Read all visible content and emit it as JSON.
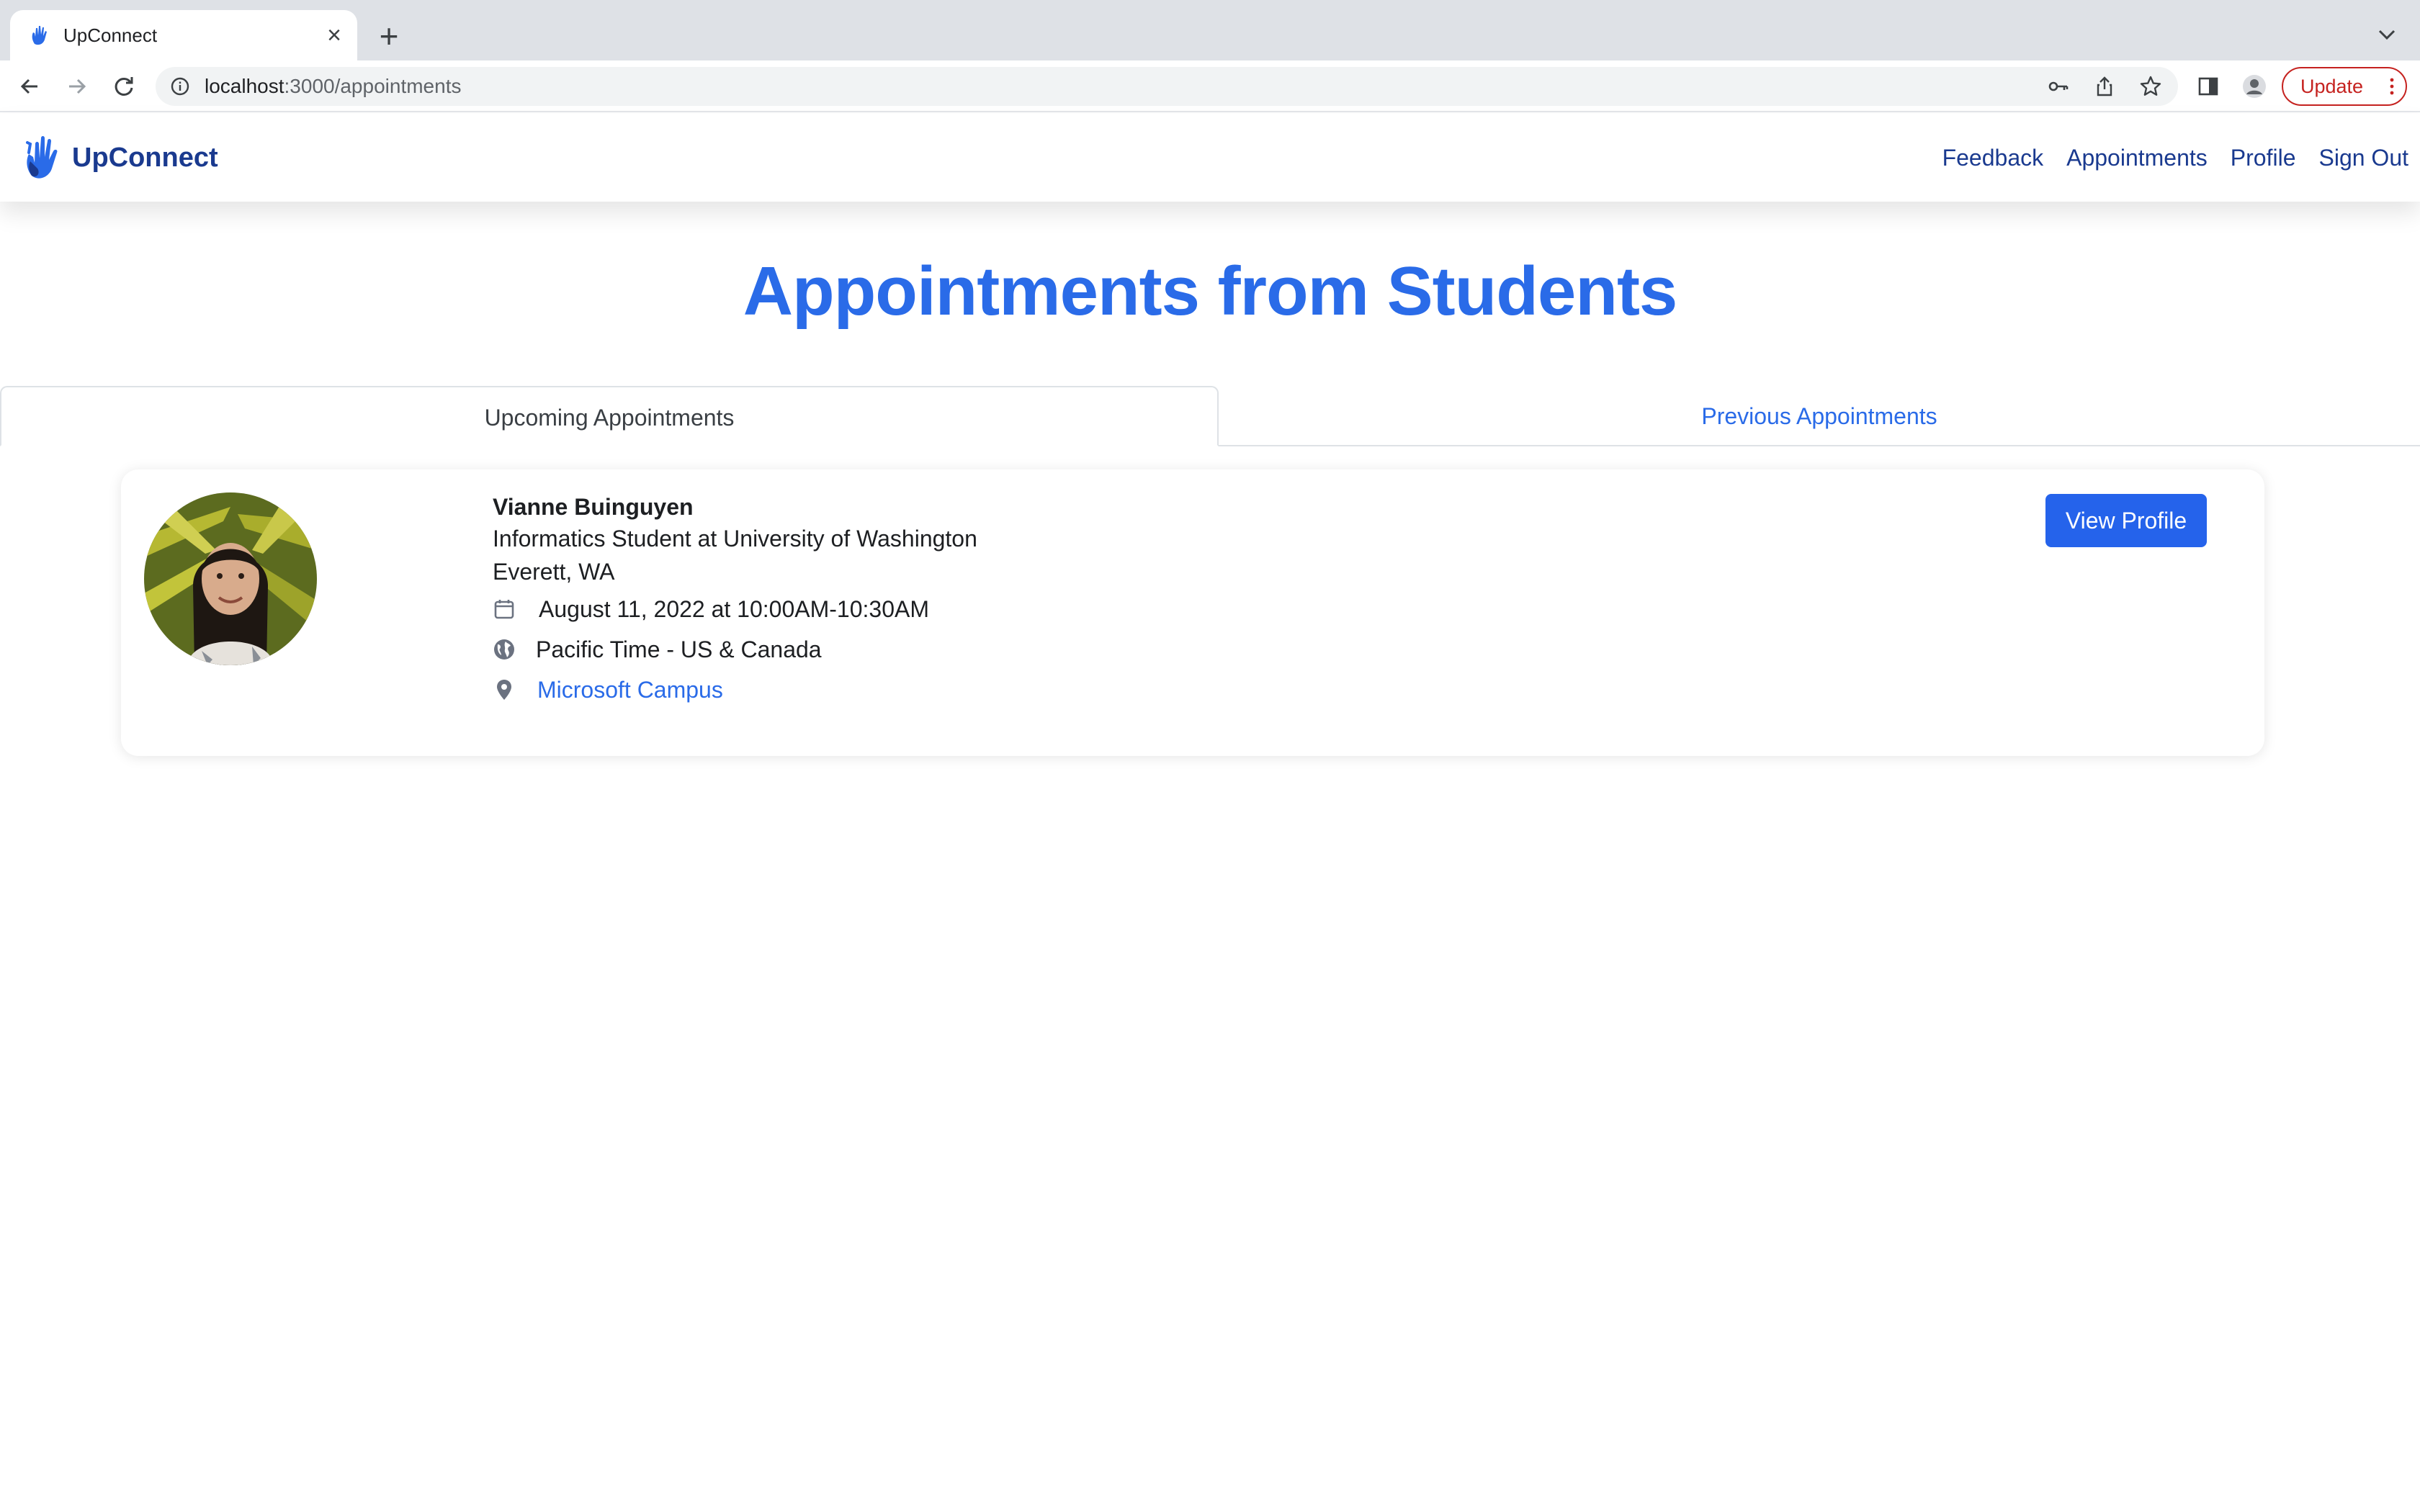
{
  "browser": {
    "tab_title": "UpConnect",
    "url_host": "localhost",
    "url_path": ":3000/appointments",
    "update_label": "Update"
  },
  "app": {
    "brand": "UpConnect",
    "nav": {
      "feedback": "Feedback",
      "appointments": "Appointments",
      "profile": "Profile",
      "sign_out": "Sign Out"
    }
  },
  "page": {
    "title": "Appointments from Students",
    "tabs": {
      "upcoming": "Upcoming Appointments",
      "previous": "Previous Appointments"
    }
  },
  "appointment": {
    "name": "Vianne Buinguyen",
    "headline": "Informatics Student at University of Washington",
    "location": "Everett, WA",
    "datetime": "August 11, 2022 at 10:00AM-10:30AM",
    "timezone": "Pacific Time - US & Canada",
    "venue": "Microsoft Campus",
    "view_profile_label": "View Profile"
  },
  "colors": {
    "accent": "#2a6be8",
    "brand_dark": "#1a3a8f",
    "button": "#2563eb",
    "update": "#c5221f"
  }
}
